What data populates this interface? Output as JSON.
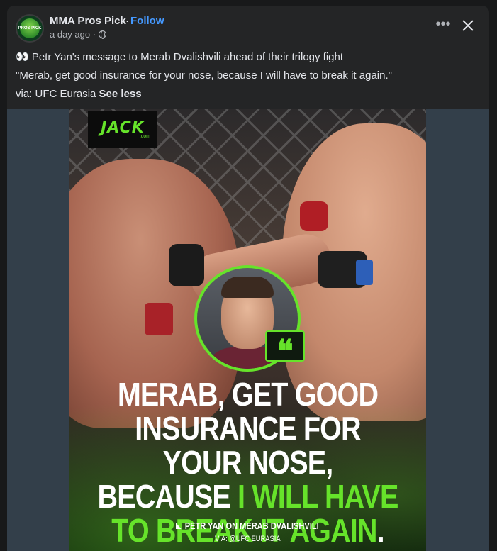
{
  "post": {
    "page_name": "MMA Pros Pick",
    "separator": "·",
    "follow_label": "Follow",
    "timestamp": "a day ago",
    "meta_separator": "·",
    "more_label": "•••",
    "avatar_text": "PROS PICK",
    "text_line1": "👀 Petr Yan's message to Merab Dvalishvili ahead of their trilogy fight",
    "text_line2": "\"Merab, get good insurance for your nose, because I will have to break it again.\"",
    "text_line3_prefix": "via: UFC Eurasia ",
    "see_less_label": "See less"
  },
  "image": {
    "brand_main": "JACK",
    "brand_sub": ".com",
    "quote_glyph": "❝",
    "headline_line1": "MERAB, GET GOOD",
    "headline_line2": "INSURANCE FOR YOUR NOSE,",
    "headline_line3_white": "BECAUSE ",
    "headline_line3_green": "I WILL HAVE",
    "headline_line4_green": "TO BREAK IT AGAIN",
    "headline_line4_end": ".",
    "attribution": "PETR YAN ON MERAB DVALISHVILI",
    "via": "VIA: @UFC EURASIA"
  },
  "colors": {
    "background": "#18191a",
    "card": "#242526",
    "follow": "#4599ff",
    "accent_green": "#66e32a",
    "text_primary": "#e4e6eb",
    "text_secondary": "#b0b3b8"
  },
  "icons": {
    "avatar": "mma-pros-pick-logo",
    "globe": "globe-icon",
    "more": "more-options-icon",
    "close": "close-icon",
    "quote": "quote-icon"
  }
}
